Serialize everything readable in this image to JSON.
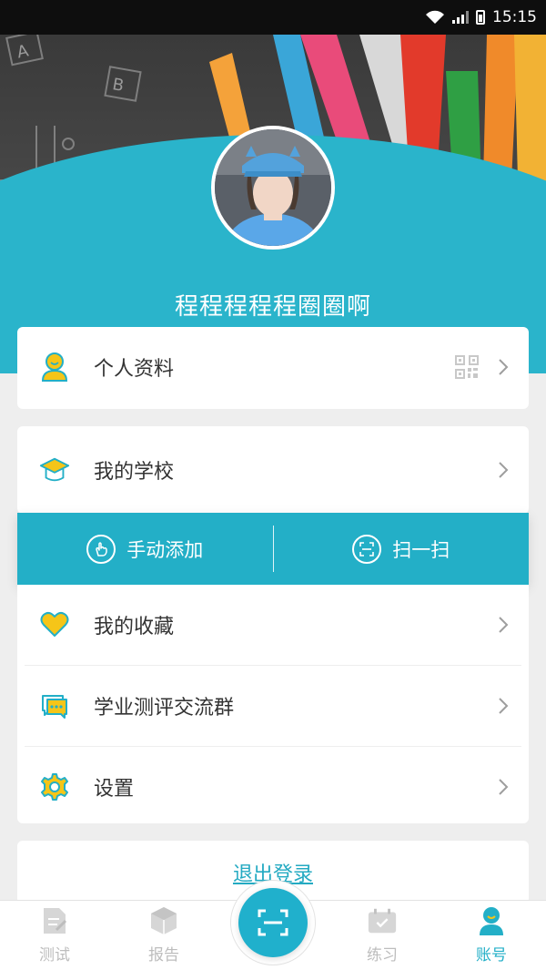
{
  "statusbar": {
    "time": "15:15"
  },
  "profile": {
    "username": "程程程程程圈圈啊"
  },
  "menu": {
    "personal": {
      "label": "个人资料"
    },
    "school": {
      "label": "我的学校"
    },
    "favorites": {
      "label": "我的收藏"
    },
    "group": {
      "label": "学业测评交流群"
    },
    "settings": {
      "label": "设置"
    }
  },
  "actions": {
    "manual_add": "手动添加",
    "scan": "扫一扫"
  },
  "logout": {
    "label": "退出登录"
  },
  "tabs": [
    {
      "label": "测试",
      "icon": "test-icon"
    },
    {
      "label": "报告",
      "icon": "report-icon"
    },
    {
      "label": "",
      "icon": "scan-icon"
    },
    {
      "label": "练习",
      "icon": "practice-icon"
    },
    {
      "label": "账号",
      "icon": "account-icon"
    }
  ],
  "colors": {
    "accent": "#23afc7",
    "icon_yellow": "#f5c518",
    "tab_inactive": "#bdbdbd"
  }
}
